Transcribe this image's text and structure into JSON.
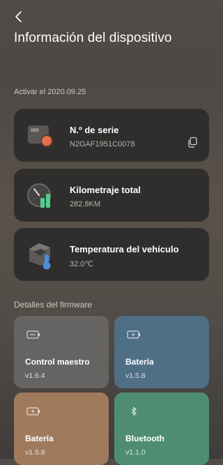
{
  "header": {
    "title": "Información del dispositivo"
  },
  "activation_text": "Activar el 2020.09.25",
  "cards": [
    {
      "label": "N.º de serie",
      "value": "N2GAF1951C0078",
      "icon": "scooter-controller-icon"
    },
    {
      "label": "Kilometraje total",
      "value": "282.8KM",
      "icon": "odometer-icon"
    },
    {
      "label": "Temperatura del vehículo",
      "value": "32.0℃",
      "icon": "thermometer-icon"
    }
  ],
  "firmware": {
    "title": "Detalles del firmware",
    "tiles": [
      {
        "label": "Control maestro",
        "version": "v1.6.4",
        "color": "#666462",
        "icon": "controller-chip-icon"
      },
      {
        "label": "Batería",
        "version": "v1.5.8",
        "color": "#4f6f87",
        "icon": "battery-icon"
      },
      {
        "label": "Batería",
        "version": "v1.5.8",
        "color": "#a07a5d",
        "icon": "battery-icon"
      },
      {
        "label": "Bluetooth",
        "version": "v1.1.0",
        "color": "#4f8d72",
        "icon": "bluetooth-icon"
      }
    ]
  },
  "colors": {
    "card_bg": "#2f2e2d",
    "accent_orange": "#e2704a",
    "accent_green": "#4bd08a",
    "accent_blue": "#4c8ed8"
  }
}
